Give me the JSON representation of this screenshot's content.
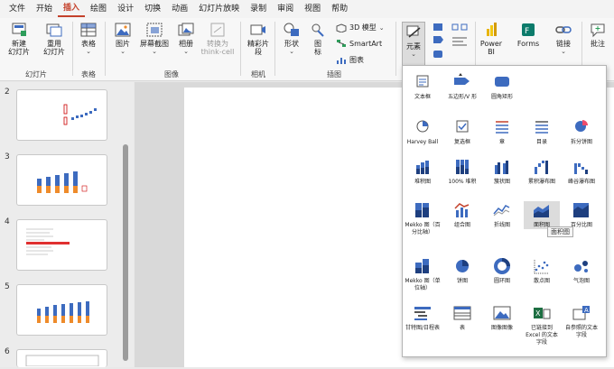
{
  "menu": {
    "items": [
      "文件",
      "开始",
      "插入",
      "绘图",
      "设计",
      "切换",
      "动画",
      "幻灯片放映",
      "录制",
      "审阅",
      "视图",
      "帮助"
    ],
    "active": "插入"
  },
  "ribbon": {
    "new_slide": "新建\n幻灯片",
    "reuse_slide": "重用\n幻灯片",
    "group_slides": "幻灯片",
    "table": "表格",
    "group_table": "表格",
    "picture": "图片",
    "screenshot": "屏幕截图",
    "album": "相册",
    "convert": "转换为\nthink-cell",
    "group_images": "图像",
    "clip": "精彩片\n段",
    "group_camera": "相机",
    "shapes": "形状",
    "icons": "图\n标",
    "model3d": "3D 模型",
    "smartart": "SmartArt",
    "chart": "图表",
    "group_illus": "插图",
    "elements": "元素",
    "powerbi": "Power\nBI",
    "forms": "Forms",
    "link": "链接",
    "comment": "批注"
  },
  "slides": {
    "numbers": [
      "2",
      "3",
      "4",
      "5",
      "6"
    ]
  },
  "elements_gallery": {
    "items": [
      {
        "label": "文本框",
        "icon": "textbox-icon"
      },
      {
        "label": "五边形/V 形",
        "icon": "pentagon-icon"
      },
      {
        "label": "圆角矩形",
        "icon": "rounded-rect-icon"
      },
      {
        "label": "Harvey Ball",
        "icon": "harvey-ball-icon"
      },
      {
        "label": "复选框",
        "icon": "checkbox-icon"
      },
      {
        "label": "章",
        "icon": "chapter-icon"
      },
      {
        "label": "目录",
        "icon": "toc-icon"
      },
      {
        "label": "拆分饼图",
        "icon": "split-pie-icon"
      },
      {
        "label": "堆积图",
        "icon": "stacked-chart-icon"
      },
      {
        "label": "100% 堆积",
        "icon": "stacked100-chart-icon"
      },
      {
        "label": "簇状图",
        "icon": "clustered-chart-icon"
      },
      {
        "label": "累积瀑布图",
        "icon": "waterfall-icon"
      },
      {
        "label": "峰谷瀑布图",
        "icon": "peak-waterfall-icon"
      },
      {
        "label": "Mekko 图（百分比轴）",
        "icon": "mekko-percent-icon"
      },
      {
        "label": "组合图",
        "icon": "combo-chart-icon"
      },
      {
        "label": "折线图",
        "icon": "line-chart-icon"
      },
      {
        "label": "面积图",
        "icon": "area-chart-icon"
      },
      {
        "label": "百分比图",
        "icon": "percent-area-icon"
      },
      {
        "label": "Mekko 图（单位轴）",
        "icon": "mekko-unit-icon"
      },
      {
        "label": "饼图",
        "icon": "pie-chart-icon"
      },
      {
        "label": "圆环图",
        "icon": "donut-chart-icon"
      },
      {
        "label": "散点图",
        "icon": "scatter-chart-icon"
      },
      {
        "label": "气泡图",
        "icon": "bubble-chart-icon"
      },
      {
        "label": "甘特图/日程表",
        "icon": "gantt-icon"
      },
      {
        "label": "表",
        "icon": "table-icon"
      },
      {
        "label": "图像图像",
        "icon": "image-icon"
      },
      {
        "label": "已链接到 Excel 的文本字段",
        "icon": "excel-link-icon"
      },
      {
        "label": "自参照的文本字段",
        "icon": "self-ref-text-icon"
      }
    ],
    "selected": "面积图"
  },
  "tooltip": "面积图",
  "colors": {
    "accent": "#c4412b",
    "chart_blue": "#3d6bbf",
    "chart_orange": "#ee8b2b"
  }
}
